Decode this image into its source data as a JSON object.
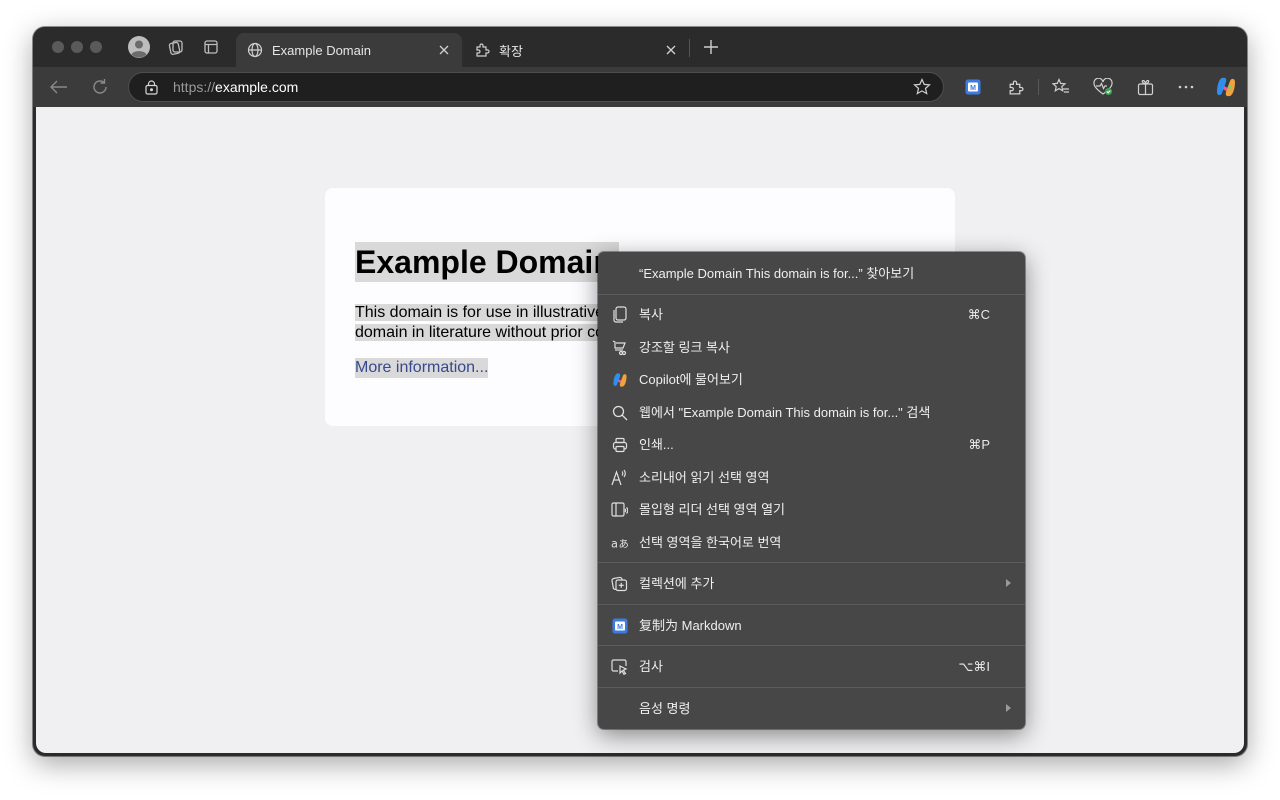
{
  "tabs": [
    {
      "title": "Example Domain",
      "icon": "globe-icon",
      "active": true
    },
    {
      "title": "확장",
      "icon": "extension-icon",
      "active": false
    }
  ],
  "address": {
    "scheme": "https://",
    "host": "example.com"
  },
  "page": {
    "title": "Example Domain",
    "paragraph_visible": [
      "This domain is for use in illustrative",
      "domain in literature without prior co"
    ],
    "link": "More information..."
  },
  "context_menu": {
    "items": [
      {
        "label": "“Example Domain This domain is for...” 찾아보기",
        "icon": "",
        "shortcut": "",
        "submenu": false
      },
      {
        "label": "복사",
        "icon": "copy-icon",
        "shortcut": "⌘C",
        "submenu": false
      },
      {
        "label": "강조할 링크 복사",
        "icon": "link-highlight-icon",
        "shortcut": "",
        "submenu": false
      },
      {
        "label": "Copilot에 물어보기",
        "icon": "copilot-icon",
        "shortcut": "",
        "submenu": false
      },
      {
        "label": "웹에서 \"Example Domain This domain is for...\" 검색",
        "icon": "search-icon",
        "shortcut": "",
        "submenu": false
      },
      {
        "label": "인쇄...",
        "icon": "print-icon",
        "shortcut": "⌘P",
        "submenu": false
      },
      {
        "label": "소리내어 읽기 선택 영역",
        "icon": "read-aloud-icon",
        "shortcut": "",
        "submenu": false
      },
      {
        "label": "몰입형 리더 선택 영역 열기",
        "icon": "immersive-reader-icon",
        "shortcut": "",
        "submenu": false
      },
      {
        "label": "선택 영역을 한국어로 번역",
        "icon": "translate-icon",
        "shortcut": "",
        "submenu": false
      },
      {
        "label": "컬렉션에 추가",
        "icon": "collections-icon",
        "shortcut": "",
        "submenu": true
      },
      {
        "label": "复制为 Markdown",
        "icon": "markdown-extension-icon",
        "shortcut": "",
        "submenu": false
      },
      {
        "label": "검사",
        "icon": "inspect-icon",
        "shortcut": "⌥⌘I",
        "submenu": false
      },
      {
        "label": "음성 명령",
        "icon": "",
        "shortcut": "",
        "submenu": true
      }
    ]
  },
  "colors": {
    "accent_link": "#38488f",
    "menu_bg": "#474747",
    "chrome_bg": "#2b2b2b",
    "toolbar_bg": "#3b3b3b",
    "page_bg": "#f0f0f2"
  }
}
